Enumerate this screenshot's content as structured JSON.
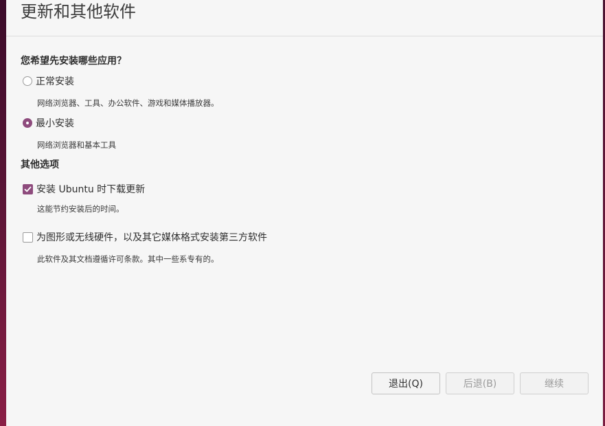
{
  "title": "更新和其他软件",
  "install_type": {
    "heading": "您希望先安装哪些应用？",
    "options": [
      {
        "label": "正常安装",
        "description": "网络浏览器、工具、办公软件、游戏和媒体播放器。",
        "selected": false
      },
      {
        "label": "最小安装",
        "description": "网络浏览器和基本工具",
        "selected": true
      }
    ]
  },
  "other_options": {
    "heading": "其他选项",
    "items": [
      {
        "label": "安装 Ubuntu 时下载更新",
        "description": "这能节约安装后的时间。",
        "checked": true
      },
      {
        "label": "为图形或无线硬件，以及其它媒体格式安装第三方软件",
        "description": "此软件及其文档遵循许可条款。其中一些系专有的。",
        "checked": false
      }
    ]
  },
  "buttons": {
    "quit": "退出(Q)",
    "back": "后退(B)",
    "continue": "继续"
  },
  "colors": {
    "accent": "#8e4b7d"
  }
}
